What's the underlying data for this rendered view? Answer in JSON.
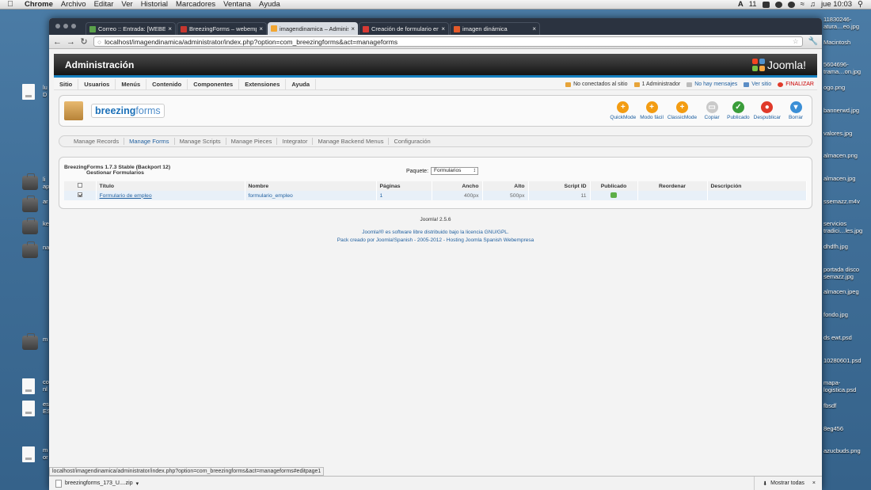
{
  "menubar": {
    "app": "Chrome",
    "items": [
      "Archivo",
      "Editar",
      "Ver",
      "Historial",
      "Marcadores",
      "Ventana",
      "Ayuda"
    ],
    "status_num": "11",
    "clock": "jue 10:03"
  },
  "desktop": {
    "right_labels": [
      "11830246-\natura…eo.jpg",
      "Macintosh",
      "5604696-\ntrama…on.jpg",
      "ogo.png",
      "bannerwd.jpg",
      "valores.jpg",
      "almacen.png",
      "almacen.jpg",
      "ssemazz.m4v",
      "servicios\ntradici…les.jpg",
      "dhdfh.jpg",
      "portada disco\nsemazz.jpg",
      "almacen.jpeg",
      "fondo.jpg",
      "ds ewt.psd",
      "10280601.psd",
      "mapa-\nlogistica.psd",
      "fbsdf",
      "8eg456",
      "azucbuds.png"
    ],
    "left_labels": [
      "lu\nD",
      "li\nap",
      "ar",
      "ke",
      "na",
      "m",
      "co\nnl",
      "es\nES",
      "m\nor"
    ]
  },
  "browser": {
    "tabs": [
      {
        "title": "Correo :: Entrada: [WEBEMP]",
        "fav": "#5ba14b",
        "active": false
      },
      {
        "title": "BreezingForms – webempre",
        "fav": "#c7372f",
        "active": false
      },
      {
        "title": "imagendinamica – Administ",
        "fav": "#f2a631",
        "active": true
      },
      {
        "title": "Creación de formulario en J",
        "fav": "#d83a34",
        "active": false
      },
      {
        "title": "imagen dinámica",
        "fav": "#e45a2a",
        "active": false
      }
    ],
    "tab_close": "×",
    "url": "localhost/imagendinamica/administrator/index.php?option=com_breezingforms&act=manageforms",
    "status_url": "localhost/imagendinamica/administrator/index.php?option=com_breezingforms&act=manageforms#editpage1"
  },
  "joomla": {
    "title": "Administración",
    "logo": "Joomla!",
    "menu": [
      "Sitio",
      "Usuarios",
      "Menús",
      "Contenido",
      "Componentes",
      "Extensiones",
      "Ayuda"
    ],
    "status": {
      "visitors": "No conectados al sitio",
      "admins": "1 Administrador",
      "messages": "No hay mensajes",
      "view_site": "Ver sitio",
      "logout": "FINALIZAR"
    },
    "component_logo": {
      "bold": "breezing",
      "light": "forms"
    },
    "toolbar": [
      {
        "label": "QuickMode",
        "color": "#f39c12",
        "glyph": "+"
      },
      {
        "label": "Modo fácil",
        "color": "#f39c12",
        "glyph": "+"
      },
      {
        "label": "ClassicMode",
        "color": "#f39c12",
        "glyph": "+"
      },
      {
        "label": "Copiar",
        "color": "#c9c9c9",
        "glyph": "▭"
      },
      {
        "label": "Publicado",
        "color": "#3a9d3a",
        "glyph": "✓"
      },
      {
        "label": "Despublicar",
        "color": "#e03a2a",
        "glyph": "●"
      },
      {
        "label": "Borrar",
        "color": "#3b8fd6",
        "glyph": "▾"
      }
    ],
    "subnav": [
      "Manage Records",
      "Manage Forms",
      "Manage Scripts",
      "Manage Pieces",
      "Integrator",
      "Manage Backend Menus",
      "Configuración"
    ],
    "subnav_active": 1,
    "version": "BreezingForms 1.7.3 Stable (Backport 12)",
    "subtitle": "Gestionar Formularios",
    "paquete_label": "Paquete:",
    "paquete_value": "Formularios",
    "table": {
      "headers": [
        "Título",
        "Nombre",
        "Páginas",
        "Ancho",
        "Alto",
        "Script ID",
        "Publicado",
        "Reordenar",
        "Descripción"
      ],
      "rows": [
        {
          "titulo": "Formulario de empleo",
          "nombre": "formulario_empleo",
          "paginas": "1",
          "ancho": "400px",
          "alto": "500px",
          "script_id": "11"
        }
      ]
    },
    "footer": {
      "version": "Joomla! 2.5.6",
      "line1": "Joomla!® es software libre distribuido bajo la licencia GNU/GPL.",
      "line2": "Pack creado por Joomla!Spanish - 2005-2012 - Hosting Joomla Spanish Webempresa"
    }
  },
  "downloads": {
    "file": "breezingforms_173_U....zip",
    "show_all": "Mostrar todas",
    "close": "×"
  }
}
